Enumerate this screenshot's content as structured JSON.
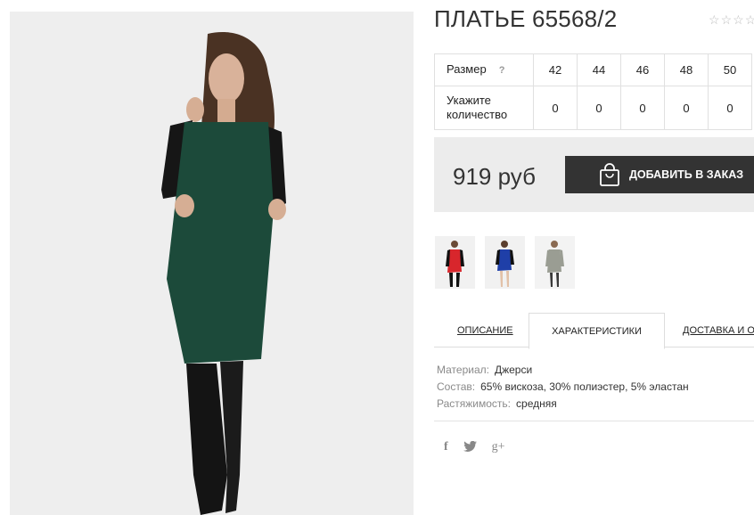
{
  "product": {
    "title": "ПЛАТЬЕ 65568/2",
    "rating_stars": [
      "☆",
      "☆",
      "☆",
      "☆"
    ]
  },
  "size_table": {
    "size_label": "Размер",
    "help_icon": "?",
    "sizes": [
      "42",
      "44",
      "46",
      "48",
      "50"
    ],
    "qty_label_line1": "Укажите",
    "qty_label_line2": "количество",
    "quantities": [
      "0",
      "0",
      "0",
      "0",
      "0"
    ]
  },
  "purchase": {
    "price": "919 руб",
    "add_button": "ДОБАВИТЬ В ЗАКАЗ",
    "button_icon": "shopping-bag-icon"
  },
  "thumbnails": [
    {
      "name": "red-dress",
      "color": "#d8262c"
    },
    {
      "name": "blue-dress",
      "color": "#1f3fa8"
    },
    {
      "name": "grey-dress",
      "color": "#9a9d93"
    }
  ],
  "tabs": {
    "description": "ОПИСАНИЕ",
    "characteristics": "ХАРАКТЕРИСТИКИ",
    "delivery": "ДОСТАВКА И ОПЛАТА"
  },
  "specs": [
    {
      "key": "Материал:",
      "value": "Джерси"
    },
    {
      "key": "Состав:",
      "value": "65% вискоза, 30% полиэстер, 5% эластан"
    },
    {
      "key": "Растяжимость:",
      "value": "средняя"
    }
  ],
  "social": {
    "facebook": "f",
    "twitter": "twitter-icon",
    "google_plus": "g+"
  },
  "colors": {
    "dress_main": "#1c4a3a",
    "button_bg": "#333333",
    "price_bg": "#ececec"
  }
}
